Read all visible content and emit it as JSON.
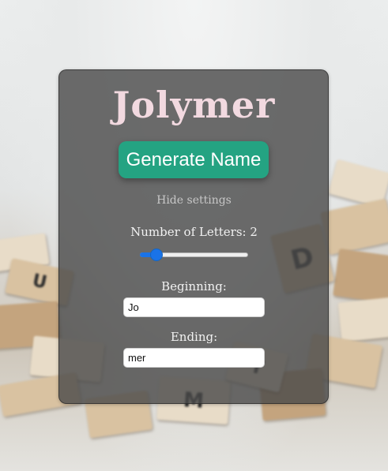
{
  "app": {
    "title": "Jolymer",
    "generate_label": "Generate Name",
    "settings_toggle_label": "Hide settings"
  },
  "settings": {
    "letters_label": "Number of Letters: 2",
    "letters_value": 2,
    "letters_min": 1,
    "letters_max": 10,
    "beginning_label": "Beginning:",
    "beginning_value": "Jo",
    "ending_label": "Ending:",
    "ending_value": "mer"
  },
  "colors": {
    "accent": "#24a382",
    "title": "#f2d9e0",
    "slider": "#1a73e8"
  }
}
